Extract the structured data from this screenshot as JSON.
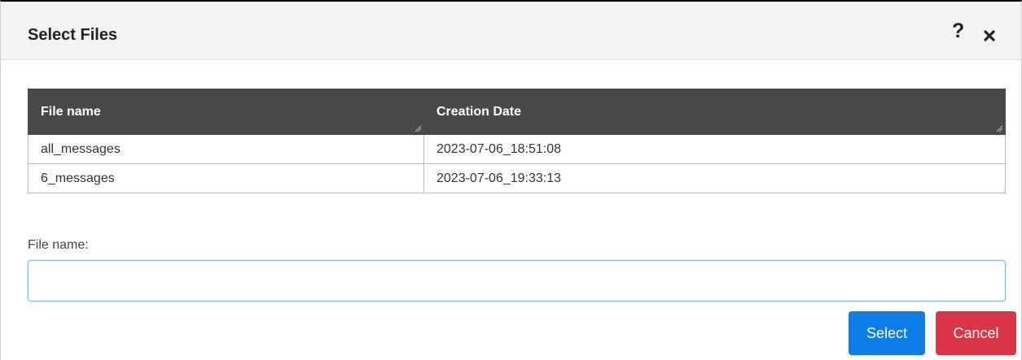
{
  "dialog": {
    "title": "Select Files",
    "help_icon": "help-icon",
    "help_glyph": "?",
    "close_icon": "close-icon"
  },
  "table": {
    "columns": [
      "File name",
      "Creation Date"
    ],
    "rows": [
      [
        "all_messages",
        "2023-07-06_18:51:08"
      ],
      [
        "6_messages",
        "2023-07-06_19:33:13"
      ]
    ]
  },
  "form": {
    "file_name_label": "File name:",
    "file_name_value": ""
  },
  "buttons": {
    "select_label": "Select",
    "cancel_label": "Cancel"
  },
  "colors": {
    "header_bg": "#4a4848",
    "select": "#0d7ee8",
    "cancel": "#dc3545"
  }
}
